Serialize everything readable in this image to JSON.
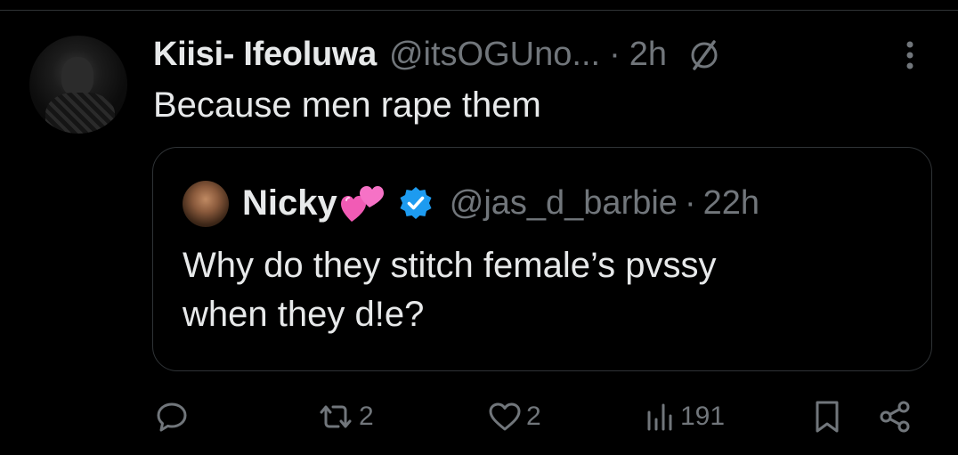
{
  "tweet": {
    "author_name": "Kiisi- Ifeoluwa",
    "author_handle": "@itsOGUno...",
    "separator": "·",
    "time": "2h",
    "text": "Because men rape them"
  },
  "quoted_tweet": {
    "author_name": "Nicky",
    "author_handle": "@jas_d_barbie",
    "separator": "·",
    "time": "22h",
    "line1": "Why do they stitch female’s pvssy",
    "line2": "when they d!e?"
  },
  "actions": {
    "replies": "",
    "reposts": "2",
    "likes": "2",
    "views": "191"
  },
  "icons": {
    "grok": "grok-slash-icon",
    "more": "more-vertical-icon",
    "verified": "verified-badge-icon",
    "reply": "reply-icon",
    "repost": "repost-icon",
    "like": "heart-icon",
    "views": "views-bar-icon",
    "bookmark": "bookmark-icon",
    "share": "share-icon"
  },
  "colors": {
    "background": "#000000",
    "text": "#e7e9ea",
    "secondary": "#71767b",
    "border": "#2f3336",
    "verified": "#1d9bf0",
    "heart_emoji": "#f15bb5"
  }
}
